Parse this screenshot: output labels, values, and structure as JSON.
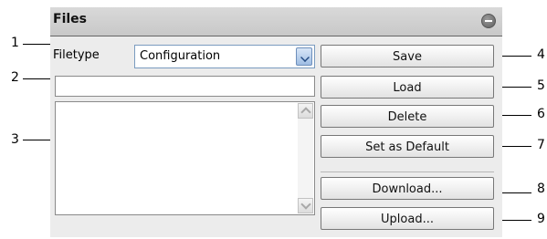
{
  "panel": {
    "title": "Files",
    "filetype_label": "Filetype",
    "filetype_selected": "Configuration",
    "filename_value": "",
    "buttons": {
      "save": "Save",
      "load": "Load",
      "delete": "Delete",
      "set_default": "Set as Default",
      "download": "Download...",
      "upload": "Upload..."
    }
  },
  "callouts": [
    "1",
    "2",
    "3",
    "4",
    "5",
    "6",
    "7",
    "8",
    "9"
  ]
}
